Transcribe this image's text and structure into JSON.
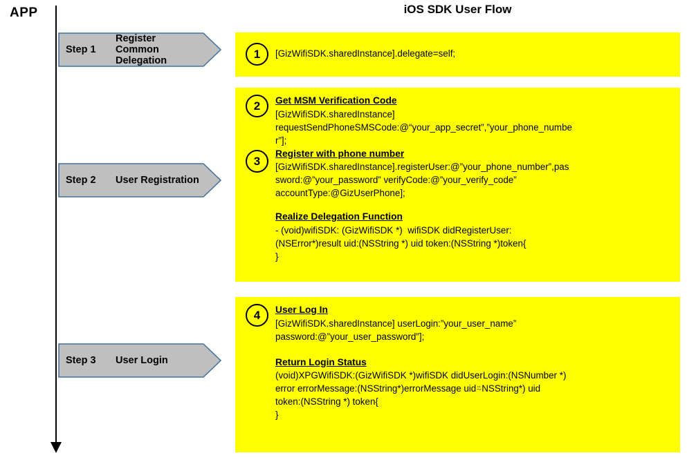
{
  "diagram": {
    "app_label": "APP",
    "title": "iOS SDK User Flow",
    "accent_yellow": "#FFFF00",
    "chevron_fill": "#BFBFBF",
    "chevron_border": "#41719C"
  },
  "steps": [
    {
      "number": "Step 1",
      "name": "Register Common\nDelegation"
    },
    {
      "number": "Step 2",
      "name": "User Registration"
    },
    {
      "number": "Step 3",
      "name": "User Login"
    }
  ],
  "panels": [
    {
      "badges": [
        "1"
      ],
      "blocks": [
        {
          "badge": "1",
          "heading": "",
          "lines": [
            "[GizWifiSDK.sharedInstance].delegate=self;"
          ]
        }
      ]
    },
    {
      "badges": [
        "2",
        "3"
      ],
      "blocks": [
        {
          "badge": "2",
          "heading": "Get MSM Verification Code",
          "lines": [
            "[GizWifiSDK.sharedInstance]",
            "requestSendPhoneSMSCode:@“your_app_secret”,”your_phone_numbe",
            "r”];"
          ]
        },
        {
          "badge": "3",
          "heading": "Register with phone number",
          "lines": [
            "[GizWifiSDK.sharedInstance].registerUser:@”your_phone_number”,pas",
            "sword:@”your_password” verifyCode:@”your_verify_code”",
            "accountType:@GizUserPhone];"
          ]
        },
        {
          "badge": "",
          "heading": "Realize Delegation Function",
          "lines": [
            "- (void)wifiSDK: (GizWifiSDK *)  wifiSDK didRegisterUser:",
            "(NSError*)result uid:(NSString *) uid token:(NSString *)token{",
            "}"
          ]
        }
      ]
    },
    {
      "badges": [
        "4"
      ],
      "blocks": [
        {
          "badge": "4",
          "heading": "User Log In",
          "lines": [
            "[GizWifiSDK.sharedInstance] userLogin:”your_user_name”",
            "password:@”your_user_password”];"
          ]
        },
        {
          "badge": "",
          "heading": "Return Login Status",
          "lines": [
            "(void)XPGWifiSDK:(GizWifiSDK *)wifiSDK didUserLogin:(NSNumber *)",
            "error errorMessage:(NSString*)errorMessage uid⍨NSString*) uid",
            "token:(NSString *) token{",
            "}"
          ]
        }
      ]
    }
  ]
}
